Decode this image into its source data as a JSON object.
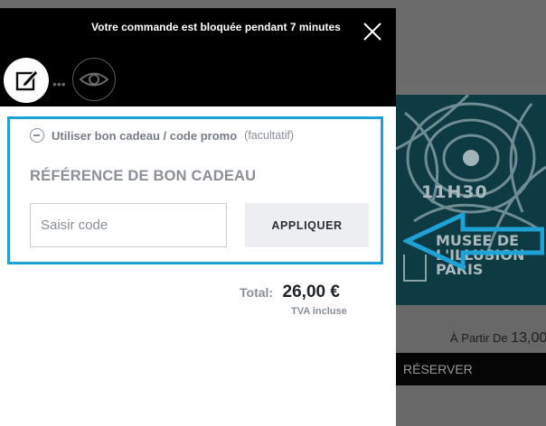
{
  "modal": {
    "timer_message": "Votre commande est bloquée pendant 7 minutes",
    "steps": [
      {
        "icon": "edit-icon"
      },
      {
        "icon": "eye-icon"
      }
    ],
    "promo": {
      "toggle_label": "Utiliser bon cadeau / code promo",
      "optional_label": "(facultatif)",
      "gift_heading": "RÉFÉRENCE DE BON CADEAU",
      "code_placeholder": "Saisir code",
      "code_value": "",
      "apply_label": "APPLIQUER"
    },
    "total": {
      "label": "Total:",
      "value": "26,00 €",
      "vat_note": "TVA incluse"
    }
  },
  "background": {
    "poster_time": "11H30",
    "poster_title": "MUSEE DE L'ILLUSION PARIS",
    "price_prefix": "À Partir De",
    "price_value": "13,00",
    "reserve_label": "RÉSERVER"
  },
  "colors": {
    "highlight": "#1ea1d4",
    "header_bg": "#000000"
  }
}
